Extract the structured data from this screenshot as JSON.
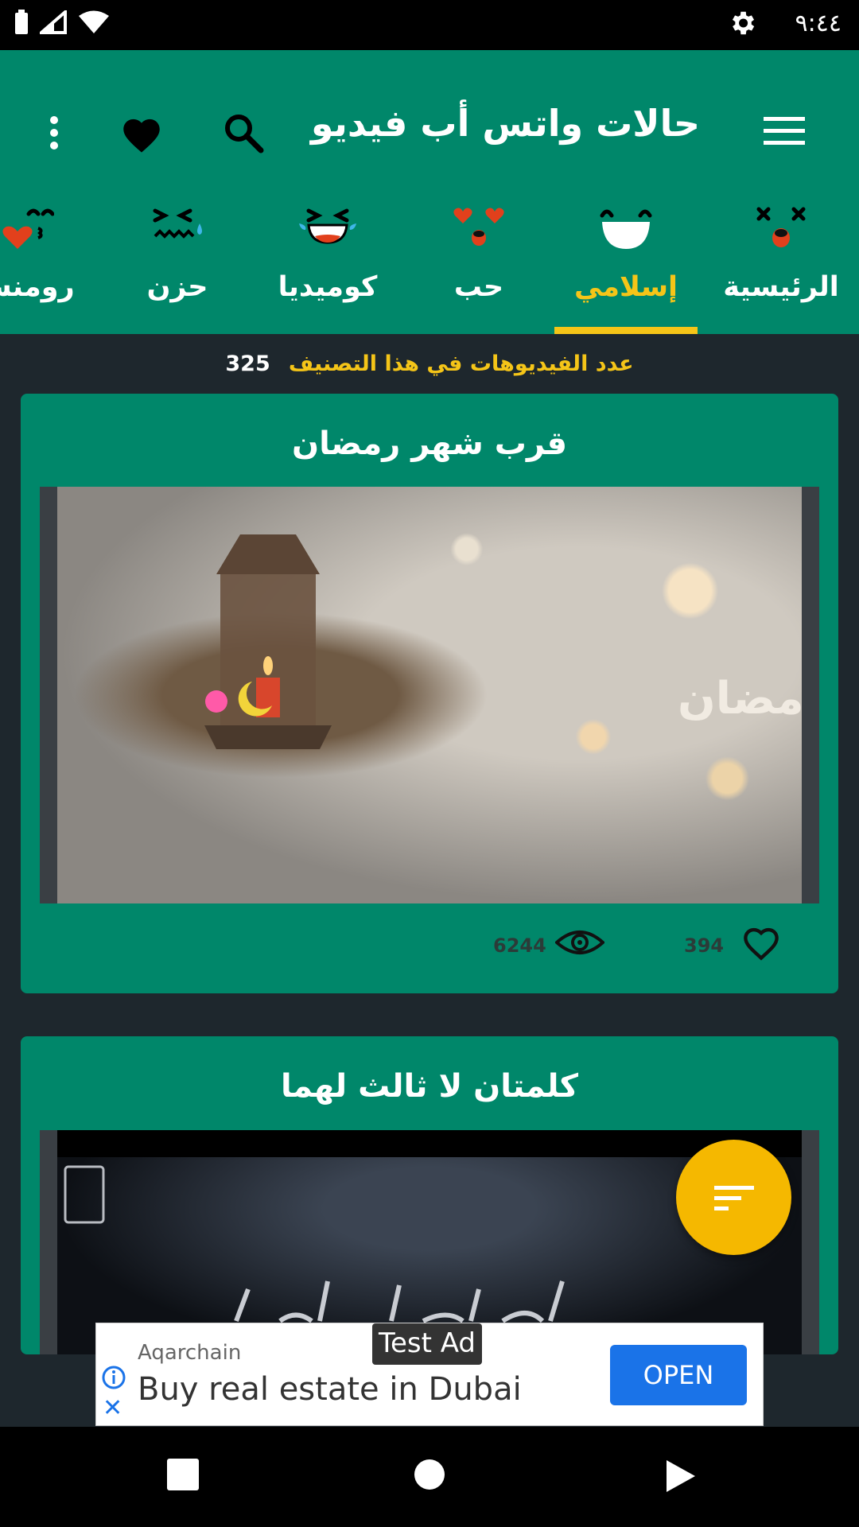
{
  "status_bar": {
    "time": "٩:٤٤"
  },
  "app_bar": {
    "title": "حالات واتس أب فيديو"
  },
  "tabs": [
    {
      "label": "الرئيسية",
      "emoji": "dizzy-face-icon"
    },
    {
      "label": "إسلامي",
      "emoji": "smile-face-icon",
      "active": true
    },
    {
      "label": "حب",
      "emoji": "heart-eyes-face-icon"
    },
    {
      "label": "كوميديا",
      "emoji": "laughing-tears-face-icon"
    },
    {
      "label": "حزن",
      "emoji": "crying-face-icon"
    },
    {
      "label": "رومنس",
      "emoji": "kissing-heart-face-icon"
    }
  ],
  "category_count": {
    "text": "عدد الفيديوهات في هذا التصنيف",
    "count": "325"
  },
  "videos": [
    {
      "title": "قرب شهر رمضان",
      "views": "6244",
      "likes": "394"
    },
    {
      "title": "كلمتان لا ثالث لهما"
    }
  ],
  "ad": {
    "badge": "Test Ad",
    "advertiser": "Aqarchain",
    "headline": "Buy real estate in Dubai",
    "cta": "OPEN"
  },
  "colors": {
    "primary": "#00876a",
    "accent": "#f5c518",
    "background": "#1e272d",
    "fab": "#f5b800"
  }
}
